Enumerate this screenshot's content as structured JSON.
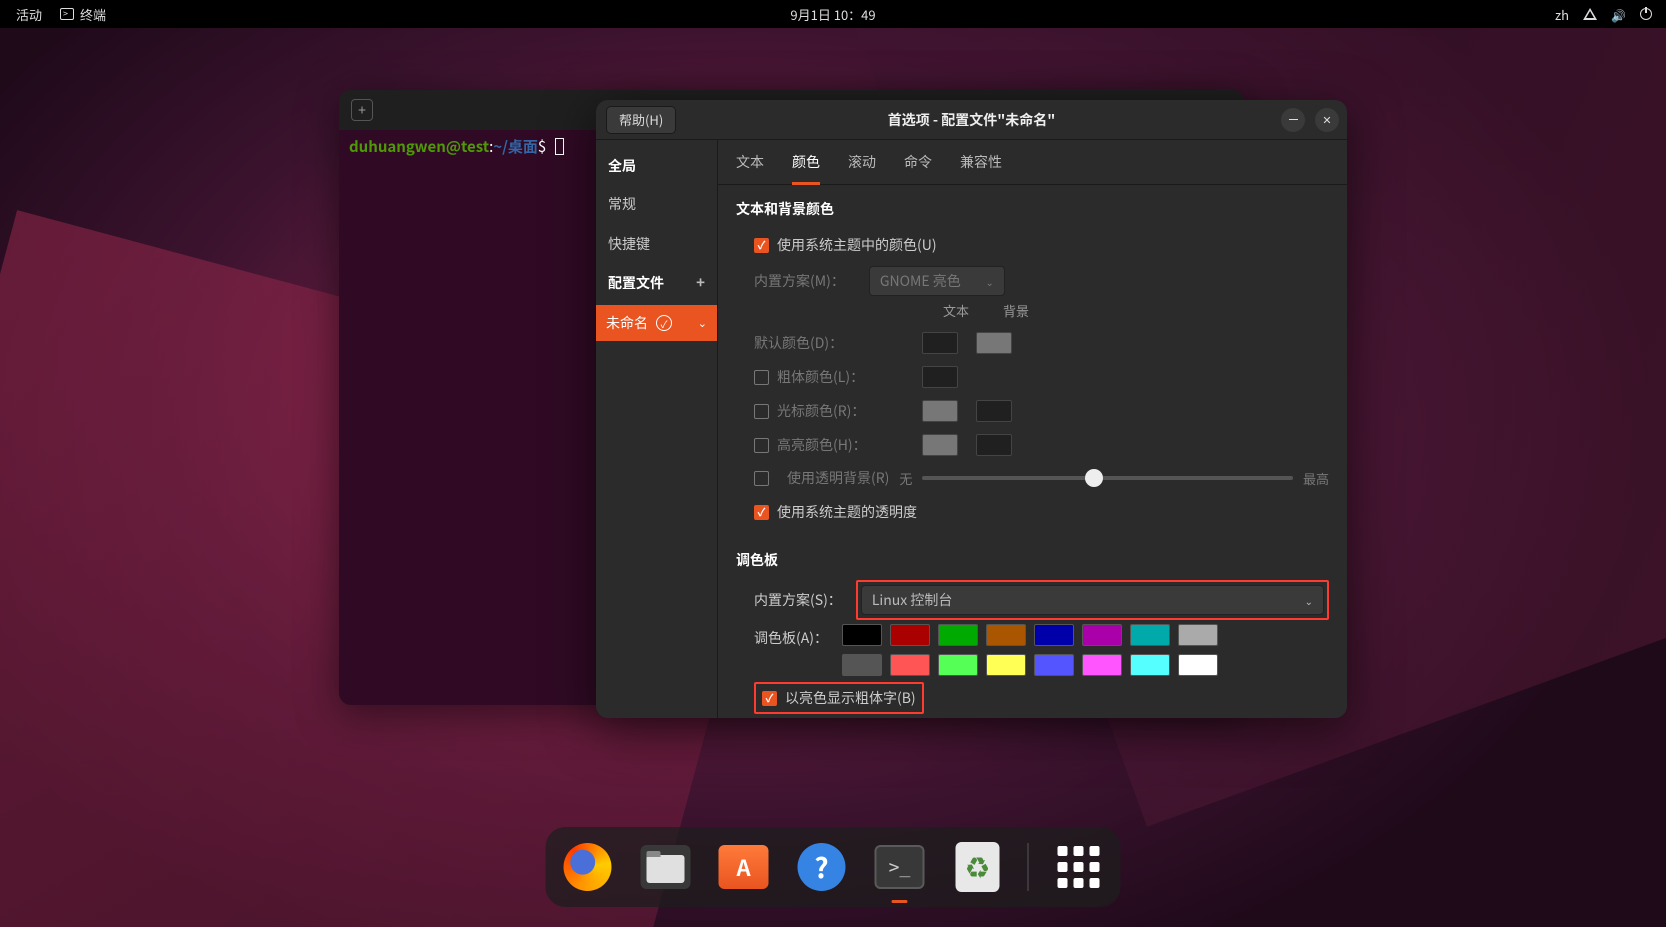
{
  "topbar": {
    "activities": "活动",
    "app_name": "终端",
    "datetime": "9月1日 10：49",
    "ime": "zh"
  },
  "terminal": {
    "prompt_user_host": "duhuangwen@test",
    "prompt_colon": ":",
    "prompt_path": "~/桌面",
    "prompt_dollar": "$"
  },
  "prefs": {
    "help_label": "帮助(H)",
    "title": "首选项 - 配置文件\"未命名\"",
    "sidebar": {
      "global": "全局",
      "general": "常规",
      "shortcuts": "快捷键",
      "profiles_heading": "配置文件",
      "profile_name": "未命名"
    },
    "tabs": {
      "text": "文本",
      "colors": "颜色",
      "scrolling": "滚动",
      "command": "命令",
      "compat": "兼容性"
    },
    "colors": {
      "section_text_bg": "文本和背景颜色",
      "use_theme_colors": "使用系统主题中的颜色(U)",
      "builtin_scheme_label": "内置方案(M)：",
      "builtin_scheme_value": "GNOME 亮色",
      "col_text": "文本",
      "col_bg": "背景",
      "default_color": "默认颜色(D)：",
      "bold_color": "粗体颜色(L)：",
      "cursor_color": "光标颜色(R)：",
      "highlight_color": "高亮颜色(H)：",
      "use_transparent_bg": "使用透明背景(R)",
      "slider_min": "无",
      "slider_max": "最高",
      "use_theme_transparency": "使用系统主题的透明度",
      "section_palette": "调色板",
      "palette_scheme_label": "内置方案(S)：",
      "palette_scheme_value": "Linux 控制台",
      "palette_label": "调色板(A)：",
      "bold_bright": "以亮色显示粗体字(B)",
      "palette_colors_row1": [
        "#000000",
        "#aa0000",
        "#00aa00",
        "#aa5500",
        "#0000aa",
        "#aa00aa",
        "#00aaaa",
        "#aaaaaa"
      ],
      "palette_colors_row2": [
        "#555555",
        "#ff5555",
        "#55ff55",
        "#ffff55",
        "#5555ff",
        "#ff55ff",
        "#55ffff",
        "#ffffff"
      ]
    }
  },
  "dock": {
    "items": [
      "firefox",
      "files",
      "software",
      "help",
      "terminal",
      "trash",
      "apps"
    ]
  }
}
